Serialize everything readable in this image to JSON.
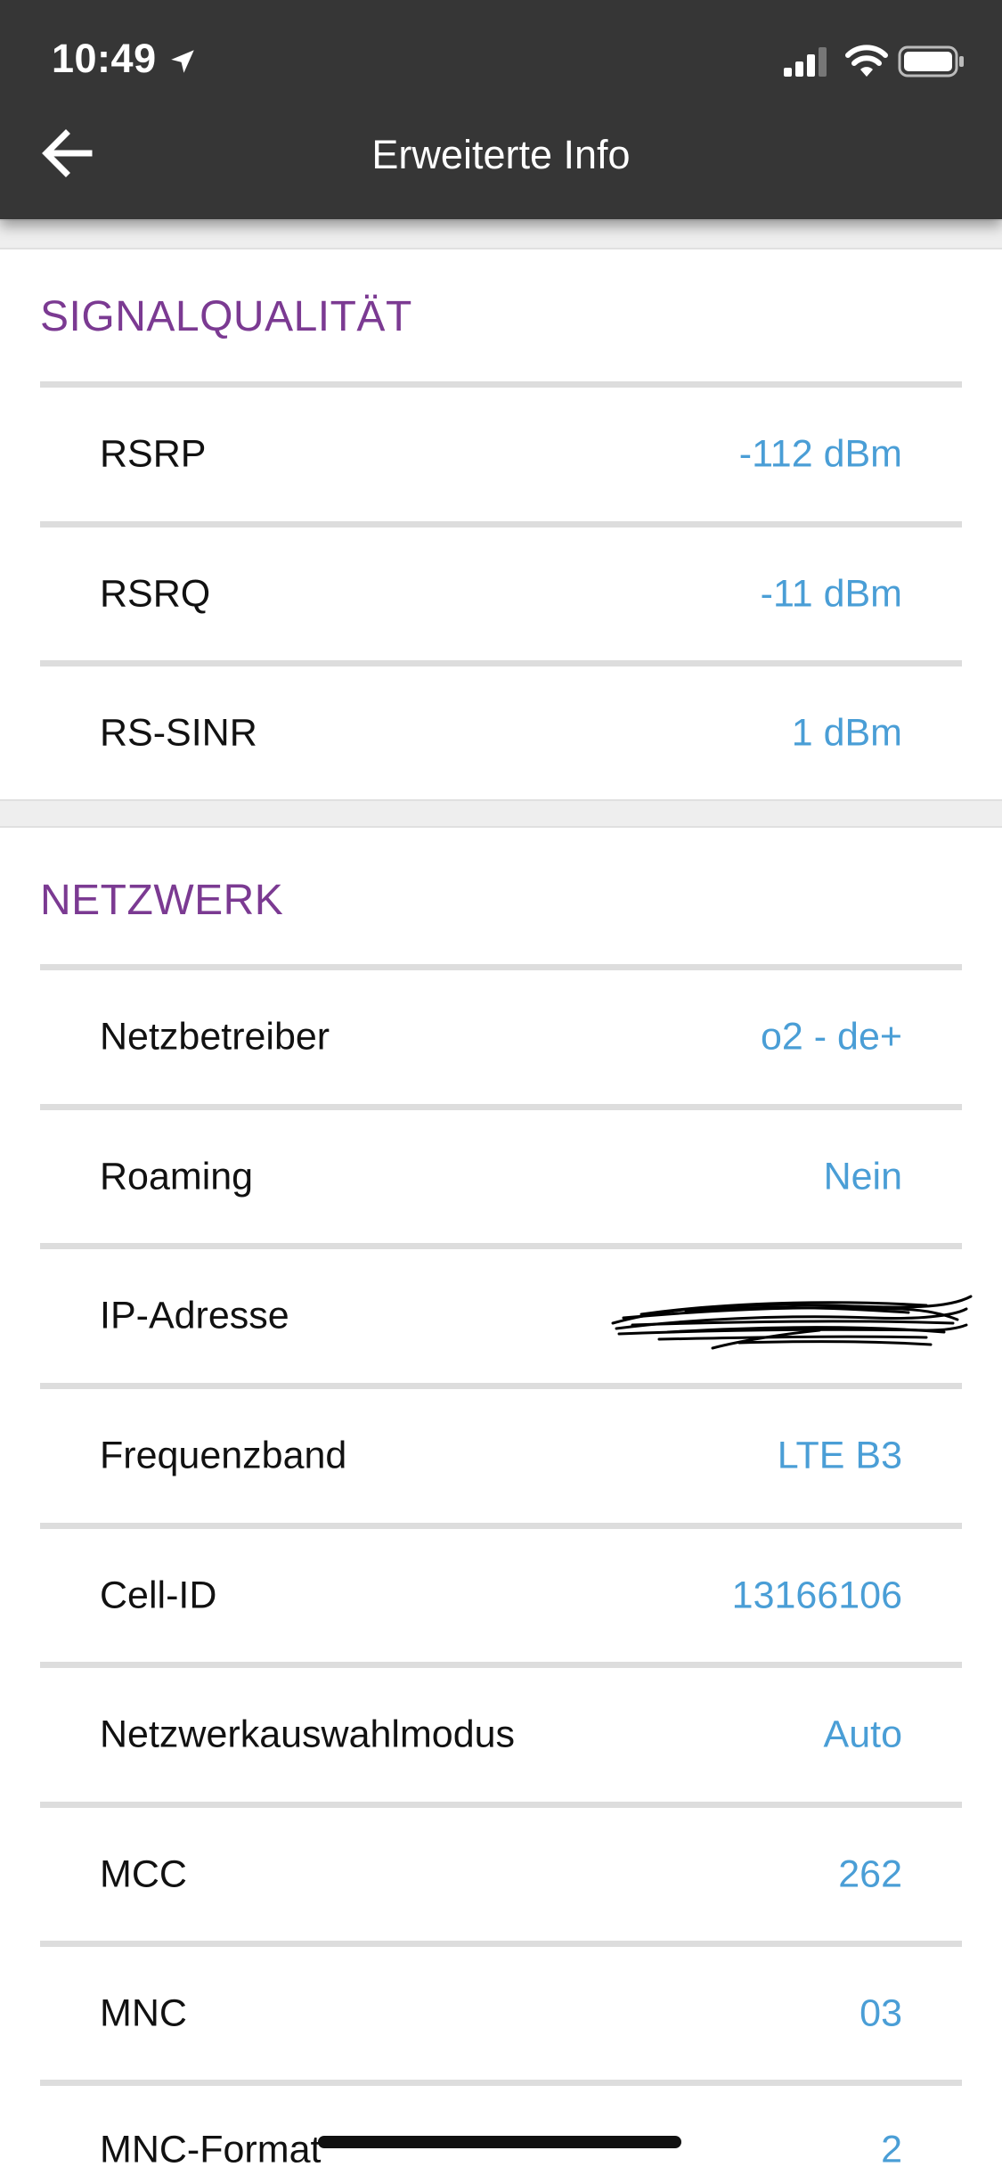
{
  "status_bar": {
    "time": "10:49"
  },
  "header": {
    "title": "Erweiterte Info"
  },
  "sections": [
    {
      "title": "SIGNALQUALITÄT",
      "rows": [
        {
          "label": "RSRP",
          "value": "-112 dBm"
        },
        {
          "label": "RSRQ",
          "value": "-11 dBm"
        },
        {
          "label": "RS-SINR",
          "value": "1 dBm"
        }
      ]
    },
    {
      "title": "NETZWERK",
      "rows": [
        {
          "label": "Netzbetreiber",
          "value": "o2 - de+"
        },
        {
          "label": "Roaming",
          "value": "Nein"
        },
        {
          "label": "IP-Adresse",
          "value": ""
        },
        {
          "label": "Frequenzband",
          "value": "LTE B3"
        },
        {
          "label": "Cell-ID",
          "value": "13166106"
        },
        {
          "label": "Netzwerkauswahlmodus",
          "value": "Auto"
        },
        {
          "label": "MCC",
          "value": "262"
        },
        {
          "label": "MNC",
          "value": "03"
        },
        {
          "label": "MNC-Format",
          "value": "2"
        }
      ]
    }
  ],
  "colors": {
    "header_bg": "#363636",
    "section_title": "#7b3a92",
    "value_text": "#4a9ed6",
    "divider": "#dddddd"
  },
  "icons": [
    "location-arrow-icon",
    "cellular-signal-icon",
    "wifi-icon",
    "battery-icon",
    "back-arrow-icon"
  ]
}
